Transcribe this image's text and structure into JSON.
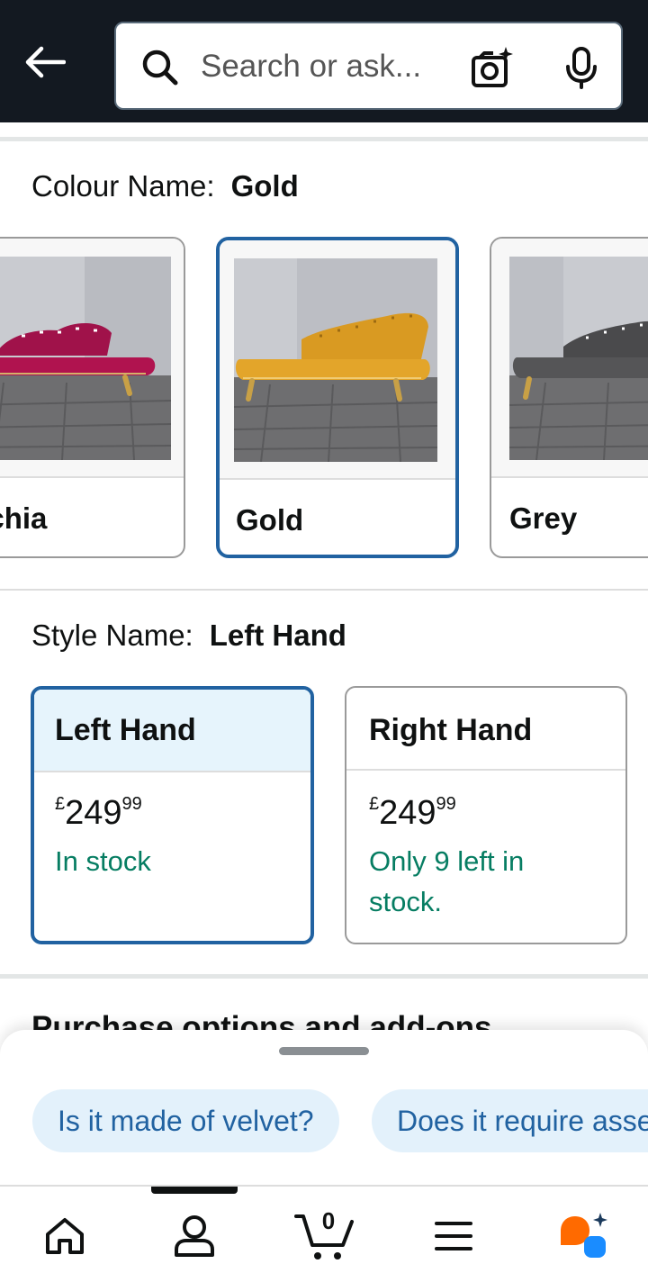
{
  "search": {
    "placeholder": "Search or ask..."
  },
  "colour": {
    "label": "Colour Name:",
    "selected": "Gold",
    "options": [
      {
        "label": "Fuchsia",
        "visible_label": "schia"
      },
      {
        "label": "Gold"
      },
      {
        "label": "Grey"
      }
    ]
  },
  "style": {
    "label": "Style Name:",
    "selected": "Left Hand",
    "options": [
      {
        "title": "Left Hand",
        "currency": "£",
        "price_whole": "249",
        "price_fraction": "99",
        "stock": "In stock"
      },
      {
        "title": "Right Hand",
        "currency": "£",
        "price_whole": "249",
        "price_fraction": "99",
        "stock": "Only 9 left in stock."
      }
    ]
  },
  "purchase": {
    "heading": "Purchase options and add-ons"
  },
  "suggestions": [
    "Is it made of velvet?",
    "Does it require assembly?"
  ],
  "nav": {
    "cart_count": "0",
    "items": [
      "home-icon",
      "account-icon",
      "cart-icon",
      "menu-icon",
      "rufus-icon"
    ]
  },
  "colors": {
    "header_bg": "#131921",
    "selected_border": "#2162a1",
    "in_stock": "#067d62",
    "chip_bg": "#e3f1fb",
    "chip_text": "#2162a1"
  }
}
